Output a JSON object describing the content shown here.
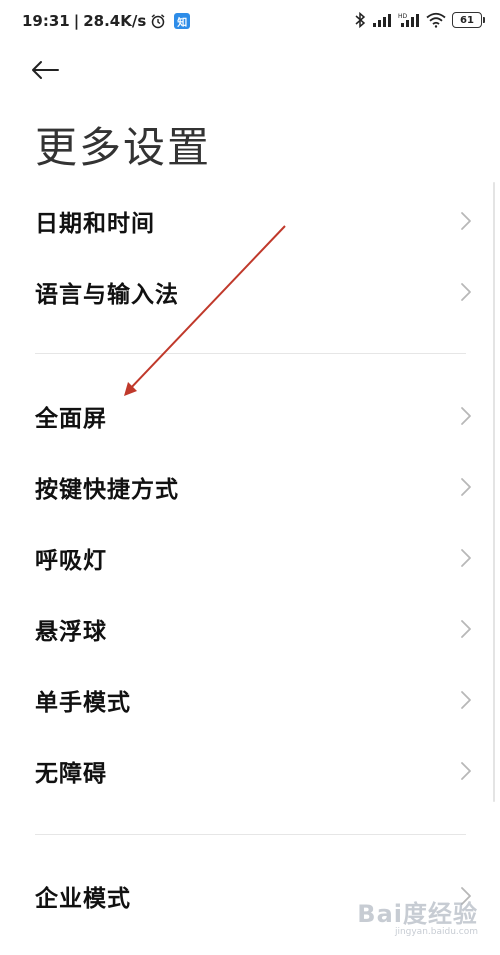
{
  "status_bar": {
    "time": "19:31",
    "separator": "|",
    "network_speed": "28.4K/s",
    "app_badge": "知",
    "battery_level": "61",
    "icons": [
      "alarm-icon",
      "bluetooth-icon",
      "signal-icon",
      "hd-signal-icon",
      "wifi-icon",
      "battery-icon"
    ]
  },
  "header": {
    "back_icon": "back-arrow-icon",
    "title": "更多设置"
  },
  "section_1": {
    "items": [
      {
        "label": "日期和时间"
      },
      {
        "label": "语言与输入法"
      }
    ]
  },
  "section_2": {
    "items": [
      {
        "label": "全面屏"
      },
      {
        "label": "按键快捷方式"
      },
      {
        "label": "呼吸灯"
      },
      {
        "label": "悬浮球"
      },
      {
        "label": "单手模式"
      },
      {
        "label": "无障碍"
      }
    ]
  },
  "section_3": {
    "items": [
      {
        "label": "企业模式"
      }
    ]
  },
  "annotation": {
    "arrow_color": "#c0392b",
    "target": "全面屏"
  },
  "watermark": {
    "main": "Bai度经验",
    "sub": "jingyan.baidu.com"
  }
}
